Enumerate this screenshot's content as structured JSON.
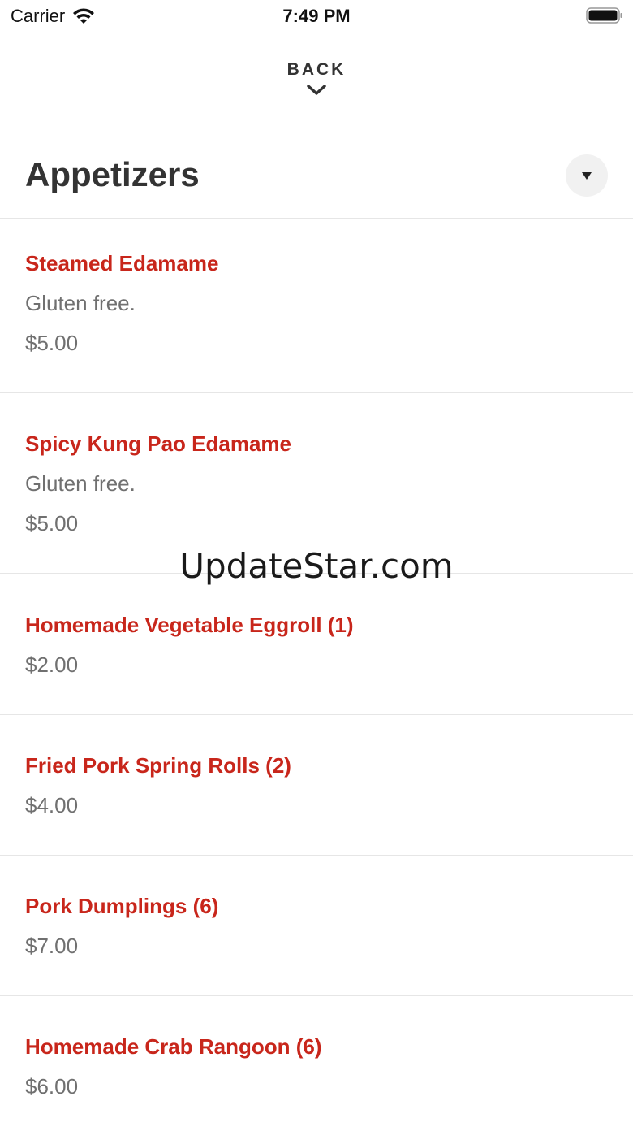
{
  "status_bar": {
    "carrier": "Carrier",
    "time": "7:49 PM"
  },
  "header": {
    "back_label": "BACK"
  },
  "category": {
    "title": "Appetizers"
  },
  "menu_items": [
    {
      "name": "Steamed Edamame",
      "description": "Gluten free.",
      "price": "$5.00"
    },
    {
      "name": "Spicy Kung Pao Edamame",
      "description": "Gluten free.",
      "price": "$5.00"
    },
    {
      "name": "Homemade Vegetable Eggroll (1)",
      "price": "$2.00"
    },
    {
      "name": "Fried Pork Spring Rolls (2)",
      "price": "$4.00"
    },
    {
      "name": "Pork Dumplings (6)",
      "price": "$7.00"
    },
    {
      "name": "Homemade Crab Rangoon (6)",
      "price": "$6.00"
    }
  ],
  "watermark": "UpdateStar.com",
  "colors": {
    "accent": "#c8261b",
    "secondary_text": "#707070",
    "divider": "#e6e6e6"
  }
}
